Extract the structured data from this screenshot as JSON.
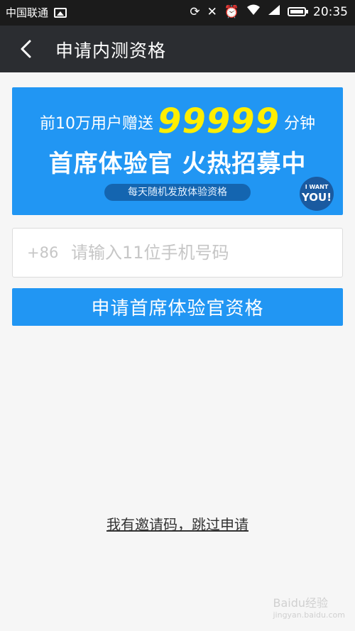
{
  "status_bar": {
    "carrier": "中国联通",
    "time": "20:35",
    "icons": [
      "image-icon",
      "sync-icon",
      "mute-icon",
      "alarm-icon",
      "wifi-icon",
      "signal-icon",
      "battery-icon"
    ]
  },
  "app_bar": {
    "title": "申请内测资格"
  },
  "banner": {
    "line1_prefix": "前10万用户赠送",
    "line1_number": "99999",
    "line1_suffix": "分钟",
    "headline": "首席体验官 火热招募中",
    "pill": "每天随机发放体验资格",
    "badge_top": "I WANT",
    "badge_bottom": "YOU!"
  },
  "phone": {
    "prefix": "+86",
    "placeholder": "请输入11位手机号码",
    "value": ""
  },
  "apply_button": {
    "label": "申请首席体验官资格"
  },
  "skip_link": {
    "label": "我有邀请码，跳过申请"
  },
  "watermark": {
    "text": "Baidu经验",
    "sub": "jingyan.baidu.com"
  },
  "colors": {
    "accent": "#2196f3",
    "app_bar": "#2b2d31",
    "status_bar": "#1b1b1b",
    "highlight_number": "#ffee00"
  }
}
